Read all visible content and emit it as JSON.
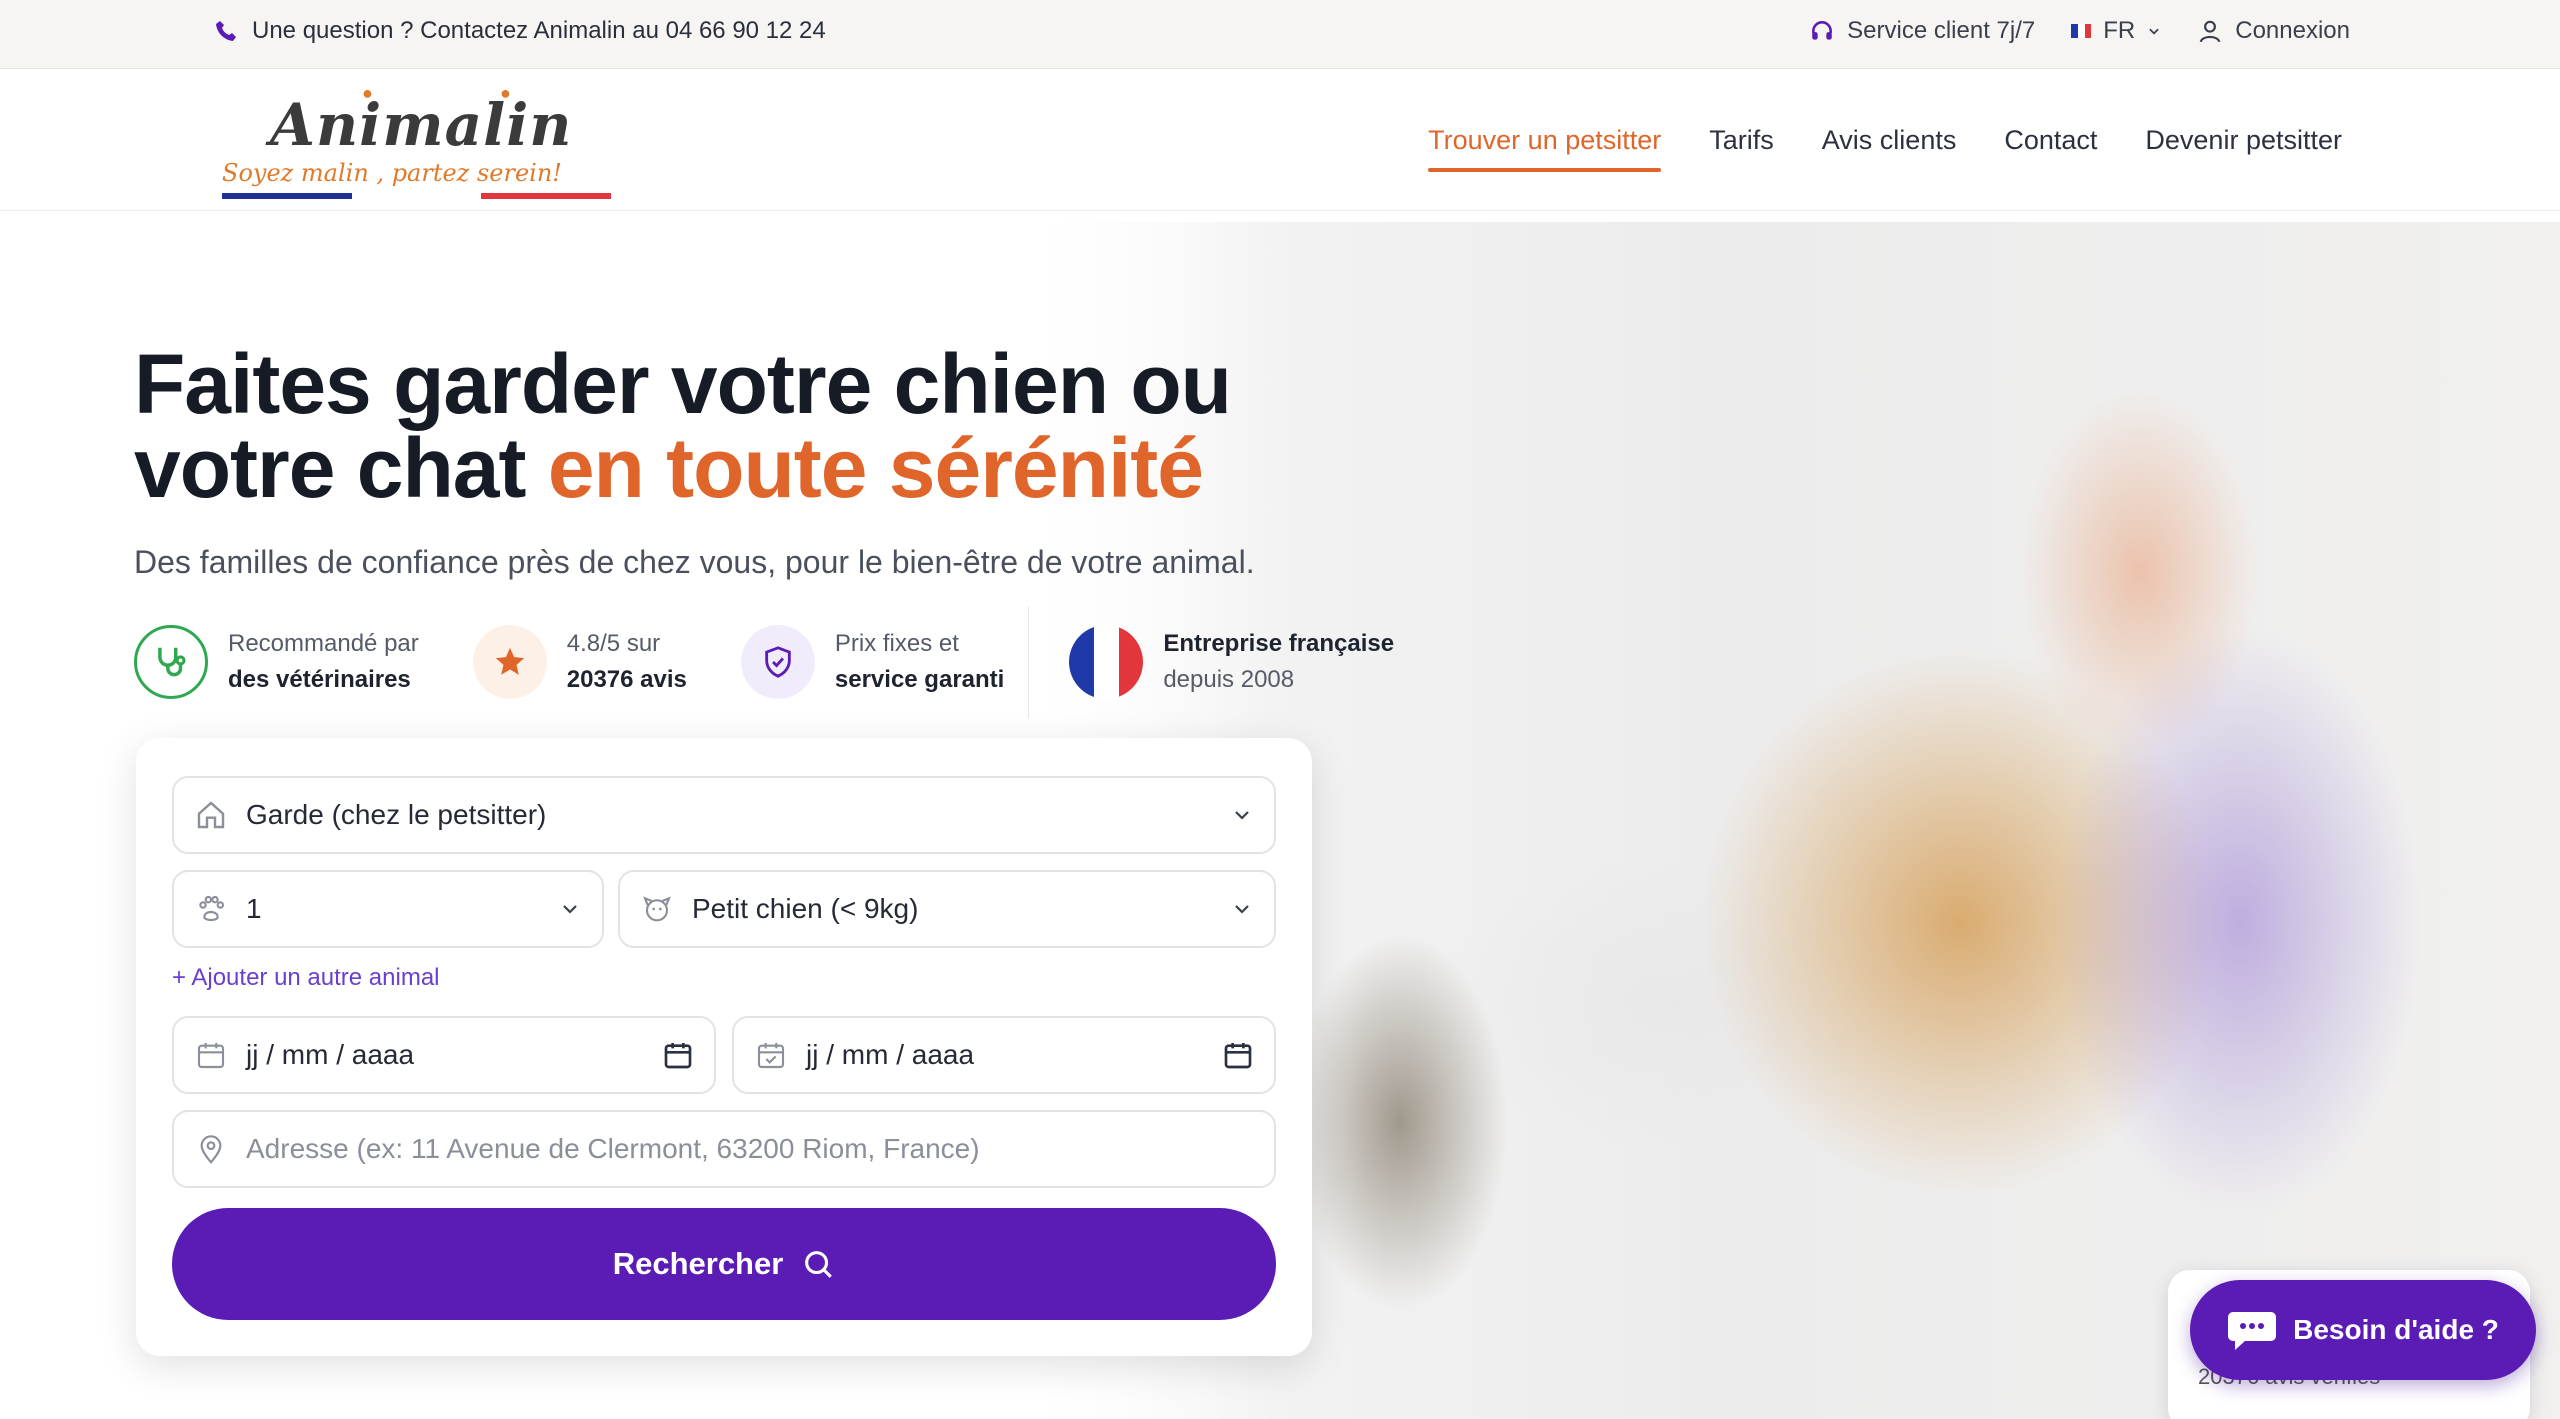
{
  "topbar": {
    "contact_text": "Une question ? Contactez Animalin au 04 66 90 12 24",
    "service_text": "Service client 7j/7",
    "language": "FR",
    "login": "Connexion"
  },
  "brand": {
    "name": "Animalin",
    "tagline": "Soyez malin , partez serein!"
  },
  "nav": {
    "items": [
      "Trouver un petsitter",
      "Tarifs",
      "Avis clients",
      "Contact",
      "Devenir petsitter"
    ],
    "active_index": 0
  },
  "hero": {
    "title_part1": "Faites garder votre chien ou votre chat ",
    "title_accent": "en toute sérénité",
    "subtitle": "Des familles de confiance près de chez vous, pour le bien-être de votre animal."
  },
  "badges": [
    {
      "line1": "Recommandé par",
      "line2": "des vétérinaires",
      "icon": "stethoscope-icon"
    },
    {
      "line1": "4.8/5 sur",
      "line2": "20376 avis",
      "icon": "star-icon"
    },
    {
      "line1": "Prix fixes et",
      "line2": "service garanti",
      "icon": "shield-check-icon"
    },
    {
      "line1": "Entreprise française",
      "line2": "depuis 2008",
      "icon": "french-flag-icon"
    }
  ],
  "search": {
    "service_type": "Garde (chez le petsitter)",
    "animal_count": "1",
    "animal_size": "Petit chien (< 9kg)",
    "add_animal_link": "+ Ajouter un autre animal",
    "start_date_placeholder": "jj / mm / aaaa",
    "end_date_placeholder": "jj / mm / aaaa",
    "address_placeholder": "Adresse (ex: 11 Avenue de Clermont, 63200 Riom, France)",
    "submit_label": "Rechercher"
  },
  "chat": {
    "label": "Besoin d'aide ?",
    "reviews_text": "20376 avis vérifiés"
  },
  "colors": {
    "accent_orange": "#e0652a",
    "primary_purple": "#5b1bb5",
    "link_purple": "#6a3fcf",
    "vet_green": "#2fa84f"
  }
}
